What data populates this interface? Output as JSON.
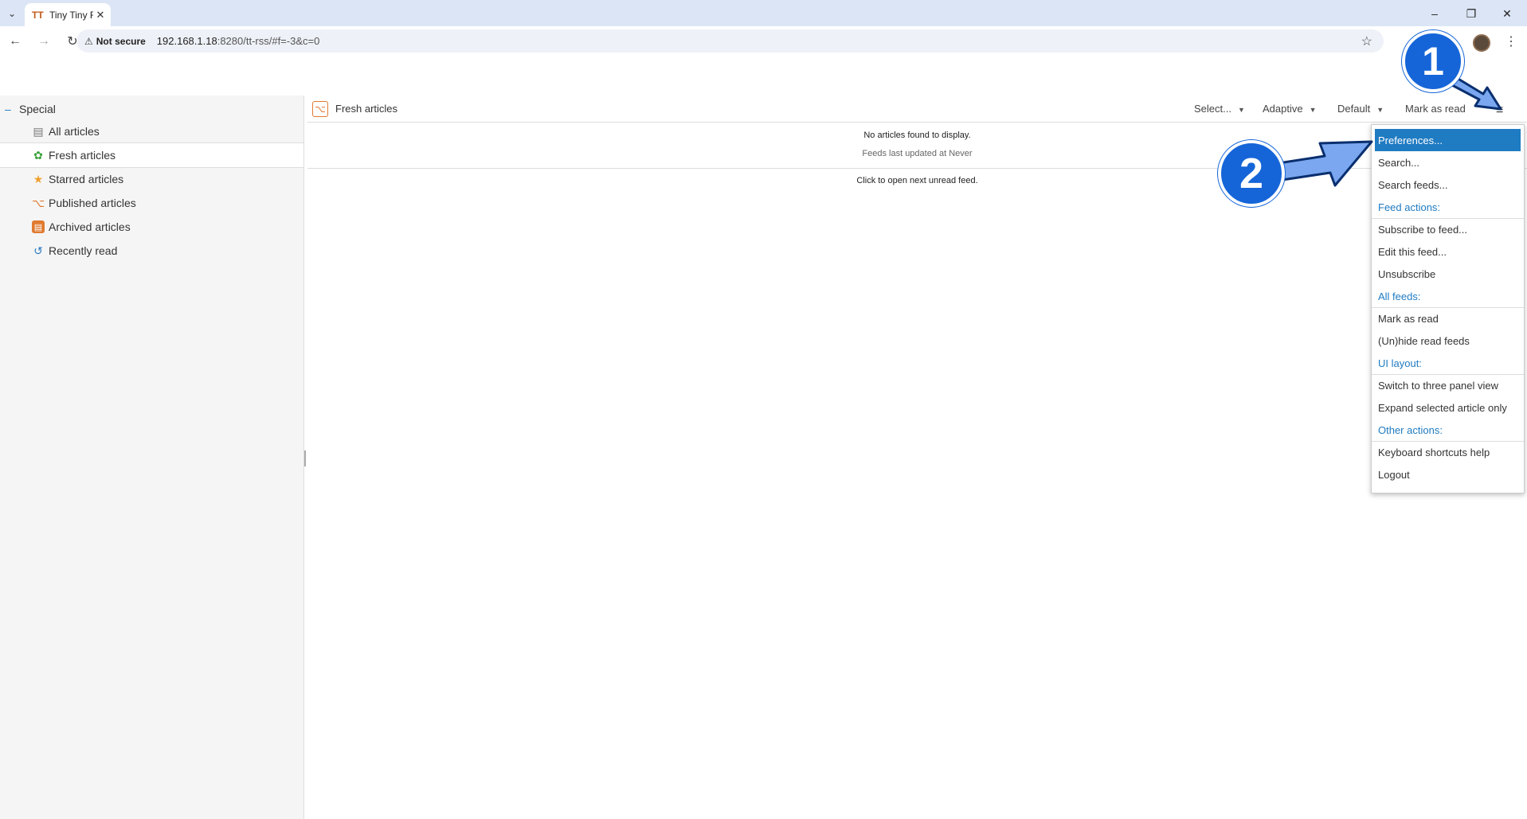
{
  "browser": {
    "tab_title": "Tiny Tiny RSS",
    "tab_favicon": "TT",
    "not_secure": "Not secure",
    "url_host": "192.168.1.18",
    "url_rest": ":8280/tt-rss/#f=-3&c=0"
  },
  "sidebar": {
    "category": "Special",
    "feeds": [
      {
        "label": "All articles",
        "icon": "inbox-icon"
      },
      {
        "label": "Fresh articles",
        "icon": "fresh-icon"
      },
      {
        "label": "Starred articles",
        "icon": "star-icon"
      },
      {
        "label": "Published articles",
        "icon": "rss-icon"
      },
      {
        "label": "Archived articles",
        "icon": "archive-icon"
      },
      {
        "label": "Recently read",
        "icon": "history-icon"
      }
    ]
  },
  "header": {
    "feed_title": "Fresh articles",
    "select": "Select...",
    "view_mode": "Adaptive",
    "order": "Default",
    "mark_as_read": "Mark as read"
  },
  "main": {
    "no_articles": "No articles found to display.",
    "last_updated": "Feeds last updated at Never",
    "next_unread": "Click to open next unread feed."
  },
  "menu": {
    "items": [
      {
        "label": "Preferences..."
      },
      {
        "label": "Search..."
      },
      {
        "label": "Search feeds..."
      },
      {
        "label": "Feed actions:"
      },
      {
        "label": "Subscribe to feed..."
      },
      {
        "label": "Edit this feed..."
      },
      {
        "label": "Unsubscribe"
      },
      {
        "label": "All feeds:"
      },
      {
        "label": "Mark as read"
      },
      {
        "label": "(Un)hide read feeds"
      },
      {
        "label": "UI layout:"
      },
      {
        "label": "Switch to three panel view"
      },
      {
        "label": "Expand selected article only"
      },
      {
        "label": "Other actions:"
      },
      {
        "label": "Keyboard shortcuts help"
      },
      {
        "label": "Logout"
      }
    ]
  },
  "annotations": {
    "step1": "1",
    "step2": "2",
    "color": "#1565d8",
    "arrow_color": "#7aa7ef"
  }
}
